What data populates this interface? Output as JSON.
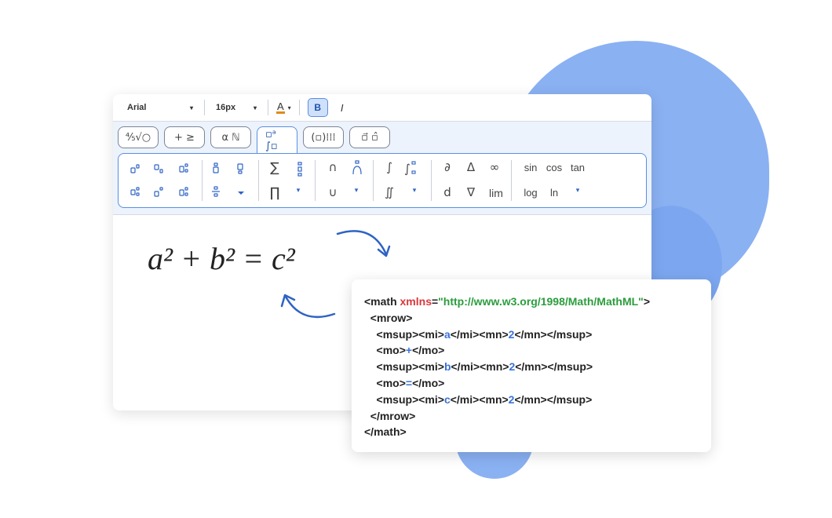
{
  "toolbar": {
    "font_family": "Arial",
    "font_size": "16px",
    "font_color_label": "A",
    "bold_label": "B",
    "italic_label": "I",
    "caret": "▾"
  },
  "tabs": [
    {
      "label": "⅘√○",
      "name": "tab-fractions-roots"
    },
    {
      "label": "+ ≥",
      "name": "tab-operators"
    },
    {
      "label": "α ℕ",
      "name": "tab-symbols"
    },
    {
      "label": "▫ᵃ ∫▫",
      "name": "tab-scripts-integrals"
    },
    {
      "label": "(▫)⁞⁞⁞",
      "name": "tab-brackets-matrices"
    },
    {
      "label": "▫⃗ ▫̂",
      "name": "tab-decorations"
    }
  ],
  "palette": {
    "sum": "∑",
    "product": "∏",
    "intersection": "∩",
    "union": "∪",
    "integral": "∫",
    "double_integral": "∬",
    "partial": "∂",
    "delta": "Δ",
    "infinity": "∞",
    "d": "d",
    "nabla": "∇",
    "lim": "lim",
    "sin": "sin",
    "cos": "cos",
    "tan": "tan",
    "log": "log",
    "ln": "ln",
    "caret": "▾"
  },
  "formula": "a² + b² = c²",
  "code": {
    "line1_open": "<math ",
    "line1_attr": "xmlns",
    "line1_eq": "=",
    "line1_str": "\"http://www.w3.org/1998/Math/MathML\"",
    "line1_close": ">",
    "line2": "  <mrow>",
    "line3_a": "    <msup><mi>",
    "line3_v": "a",
    "line3_b": "</mi><mn>",
    "line3_n": "2",
    "line3_c": "</mn></msup>",
    "line4_a": "    <mo>",
    "line4_v": "+",
    "line4_b": "</mo>",
    "line5_a": "    <msup><mi>",
    "line5_v": "b",
    "line5_b": "</mi><mn>",
    "line5_n": "2",
    "line5_c": "</mn></msup>",
    "line6_a": "    <mo>",
    "line6_v": "=",
    "line6_b": "</mo>",
    "line7_a": "    <msup><mi>",
    "line7_v": "c",
    "line7_b": "</mi><mn>",
    "line7_n": "2",
    "line7_c": "</mn></msup>",
    "line8": "  </mrow>",
    "line9": "</math>"
  },
  "colors": {
    "accent": "#5a8fe0",
    "background_blob": "#8ab1f2",
    "attr": "#d9373b",
    "string": "#2a9d3c",
    "value": "#3a72d9"
  }
}
